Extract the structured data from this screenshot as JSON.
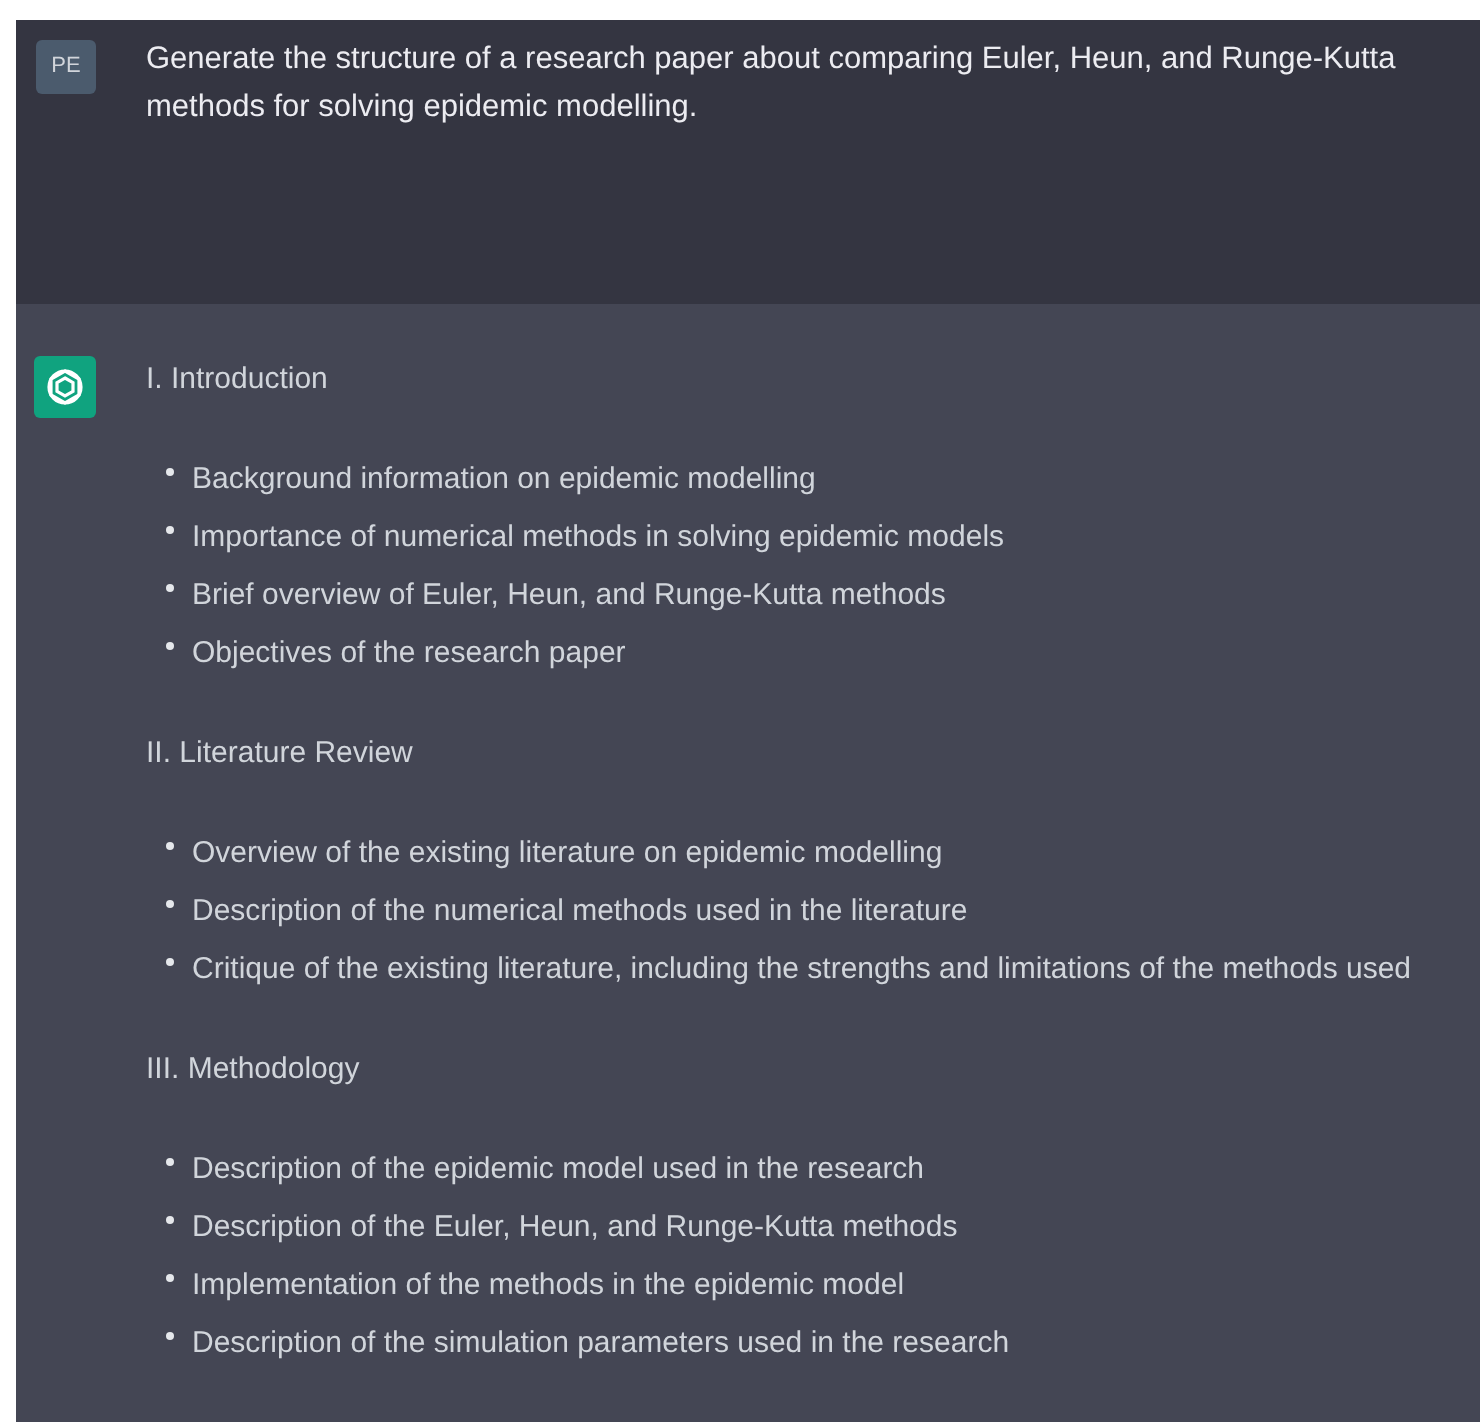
{
  "prompt": {
    "avatar": "PE",
    "text": "Generate the structure of a research paper about comparing Euler, Heun, and Runge-Kutta methods for solving epidemic modelling."
  },
  "response": {
    "sections": [
      {
        "heading": "I. Introduction",
        "items": [
          "Background information on epidemic modelling",
          "Importance of numerical methods in solving epidemic models",
          "Brief overview of Euler, Heun, and Runge-Kutta methods",
          "Objectives of the research paper"
        ]
      },
      {
        "heading": "II. Literature Review",
        "items": [
          "Overview of the existing literature on epidemic modelling",
          "Description of the numerical methods used in the literature",
          "Critique of the existing literature, including the strengths and limitations of the methods used"
        ]
      },
      {
        "heading": "III. Methodology",
        "items": [
          "Description of the epidemic model used in the research",
          "Description of the Euler, Heun, and Runge-Kutta methods",
          "Implementation of the methods in the epidemic model",
          "Description of the simulation parameters used in the research"
        ]
      }
    ]
  }
}
